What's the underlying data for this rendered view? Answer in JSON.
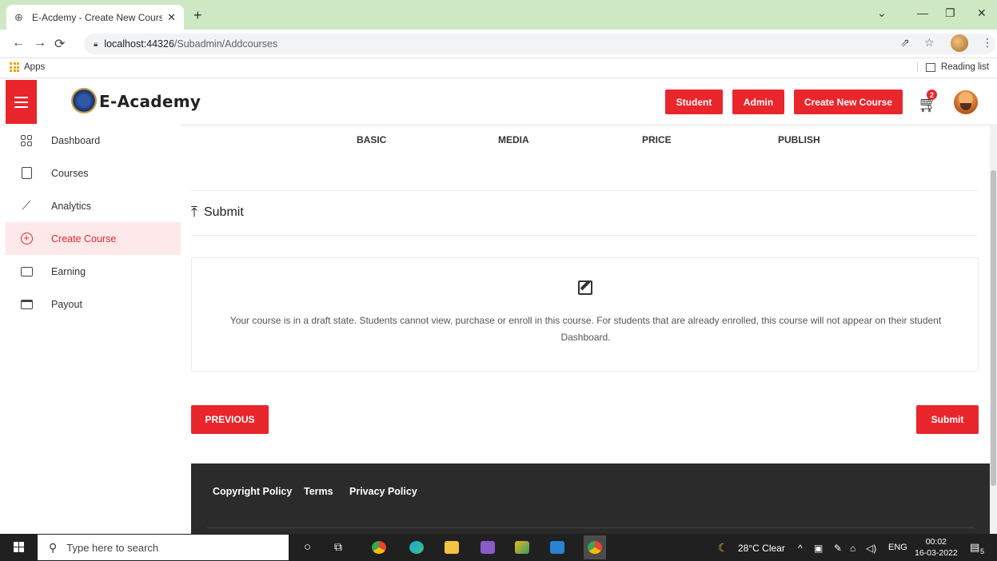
{
  "browser": {
    "tab_title": "E-Acdemy - Create New Course",
    "tab_close": "✕",
    "new_tab": "+",
    "url_host": "localhost:44326",
    "url_path": "/Subadmin/Addcourses",
    "apps_label": "Apps",
    "reading_list": "Reading list"
  },
  "header": {
    "brand": "E-Academy",
    "buttons": [
      "Student",
      "Admin",
      "Create New Course"
    ],
    "cart_count": "2"
  },
  "sidebar": {
    "items": [
      {
        "label": "Dashboard"
      },
      {
        "label": "Courses"
      },
      {
        "label": "Analytics"
      },
      {
        "label": "Create Course",
        "active": true
      },
      {
        "label": "Earning"
      },
      {
        "label": "Payout"
      }
    ]
  },
  "steps": [
    "BASIC",
    "MEDIA",
    "PRICE",
    "PUBLISH"
  ],
  "main": {
    "section_title": "Submit",
    "draft_message": "Your course is in a draft state. Students cannot view, purchase or enroll in this course. For students that are already enrolled, this course will not appear on their student Dashboard.",
    "previous_label": "PREVIOUS",
    "submit_label": "Submit"
  },
  "footer": {
    "links": [
      "Copyright Policy",
      "Terms",
      "Privacy Policy"
    ]
  },
  "taskbar": {
    "search_placeholder": "Type here to search",
    "weather": "28°C  Clear",
    "lang": "ENG",
    "time": "00:02",
    "date": "16-03-2022",
    "notifications": "5"
  },
  "colors": {
    "accent": "#e9262c",
    "active_bg": "#fde9ea",
    "footer_bg": "#2b2b2b"
  }
}
